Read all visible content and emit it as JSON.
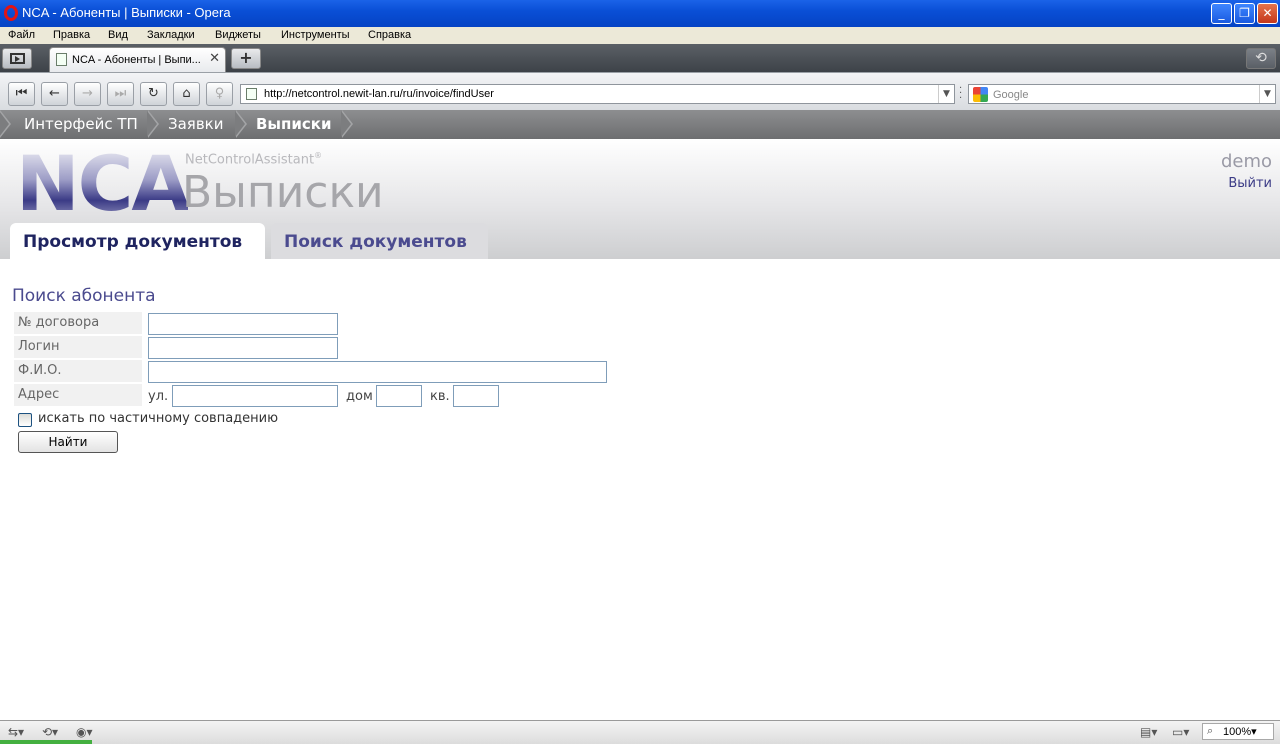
{
  "window": {
    "title": "NCA - Абоненты | Выписки - Opera"
  },
  "menu": [
    "Файл",
    "Правка",
    "Вид",
    "Закладки",
    "Виджеты",
    "Инструменты",
    "Справка"
  ],
  "tabs": [
    {
      "label": "NCA - Абоненты | Выпи..."
    }
  ],
  "address": {
    "url": "http://netcontrol.newit-lan.ru/ru/invoice/findUser"
  },
  "search": {
    "placeholder": "Google"
  },
  "breadcrumb": [
    "Интерфейс ТП",
    "Заявки",
    "Выписки"
  ],
  "header": {
    "logo": "NCA",
    "brand": "NetControlAssistant",
    "brand_mark": "®",
    "app_title": "Выписки",
    "user": "demo",
    "logout": "Выйти"
  },
  "app_tabs": [
    "Просмотр документов",
    "Поиск документов"
  ],
  "form": {
    "title": "Поиск абонента",
    "fields": {
      "contract": {
        "label": "№ договора",
        "value": ""
      },
      "login": {
        "label": "Логин",
        "value": ""
      },
      "fio": {
        "label": "Ф.И.О.",
        "value": ""
      },
      "address": {
        "label": "Адрес"
      }
    },
    "address_parts": {
      "street_label": "ул.",
      "house_label": "дом",
      "flat_label": "кв."
    },
    "partial_match_label": "искать по частичному совпадению",
    "partial_match_checked": false,
    "submit": "Найти"
  },
  "status": {
    "zoom": "100%"
  }
}
